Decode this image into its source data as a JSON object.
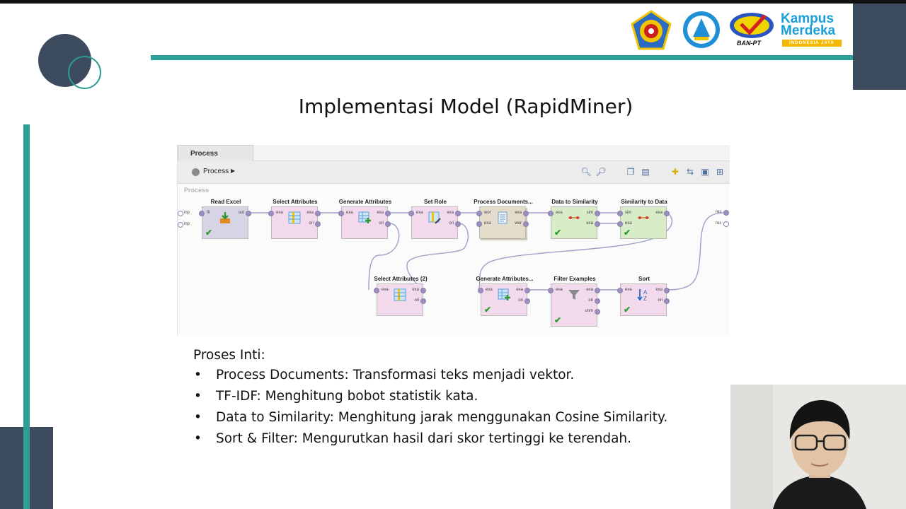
{
  "slide": {
    "title": "Implementasi Model (RapidMiner)",
    "intro": "Proses Inti:",
    "bullets": [
      "Process Documents: Transformasi teks menjadi vektor.",
      "TF-IDF: Menghitung bobot statistik kata.",
      "Data to Similarity: Menghitung jarak menggunakan Cosine Similarity.",
      "Sort & Filter: Mengurutkan hasil dari skor tertinggi ke terendah."
    ],
    "bullet_symbol": "•"
  },
  "logos": {
    "kampus_merdeka_line1": "Kampus",
    "kampus_merdeka_line2": "Merdeka",
    "kampus_merdeka_ribbon": "INDONESIA JAYA",
    "ban_pt": "BAN-PT"
  },
  "rapidminer": {
    "tab": "Process",
    "breadcrumb": "Process",
    "canvas_label": "Process",
    "operators": {
      "read_excel": {
        "title": "Read Excel",
        "in": [
          "fil"
        ],
        "out": [
          "out"
        ]
      },
      "select_attributes": {
        "title": "Select Attributes",
        "in": [
          "exa"
        ],
        "out": [
          "exa",
          "ori"
        ]
      },
      "generate_attributes": {
        "title": "Generate Attributes",
        "in": [
          "exa"
        ],
        "out": [
          "exa",
          "ori"
        ]
      },
      "set_role": {
        "title": "Set Role",
        "in": [
          "exa"
        ],
        "out": [
          "exa",
          "ori"
        ]
      },
      "process_documents": {
        "title": "Process Documents...",
        "in": [
          "wor",
          "exa"
        ],
        "out": [
          "exa",
          "wor"
        ]
      },
      "data_to_similarity": {
        "title": "Data to Similarity",
        "in": [
          "exa"
        ],
        "out": [
          "sim",
          "exa"
        ]
      },
      "similarity_to_data": {
        "title": "Similarity to Data",
        "in": [
          "sim",
          "exa"
        ],
        "out": [
          "exa"
        ]
      },
      "select_attributes_2": {
        "title": "Select Attributes (2)",
        "in": [
          "exa"
        ],
        "out": [
          "exa",
          "ori"
        ]
      },
      "generate_attributes_2": {
        "title": "Generate Attributes...",
        "in": [
          "exa"
        ],
        "out": [
          "exa",
          "ori"
        ]
      },
      "filter_examples": {
        "title": "Filter Examples",
        "in": [
          "exa"
        ],
        "out": [
          "exa",
          "ori",
          "unm"
        ]
      },
      "sort": {
        "title": "Sort",
        "in": [
          "exa"
        ],
        "out": [
          "exa",
          "ori"
        ]
      }
    },
    "process_inputs": [
      "inp",
      "inp"
    ],
    "process_outputs": [
      "res",
      "res"
    ]
  }
}
